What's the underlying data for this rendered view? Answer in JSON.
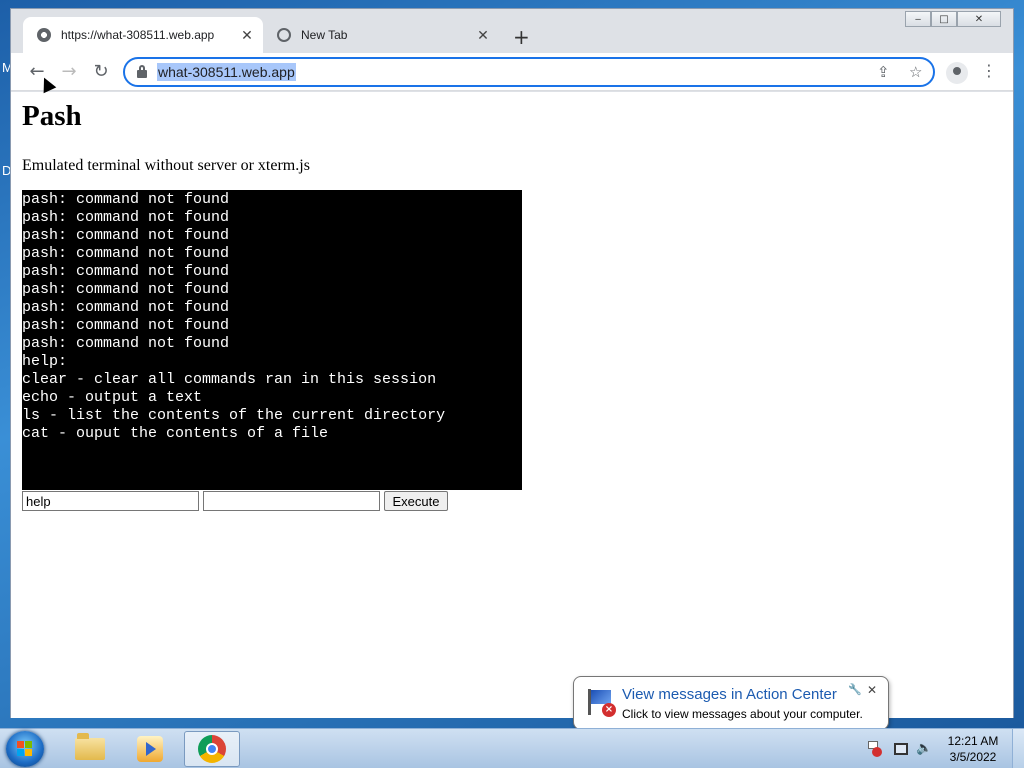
{
  "desktop": {
    "fragments": [
      "M",
      "D"
    ]
  },
  "browser": {
    "tabs": [
      {
        "title": "https://what-308511.web.app",
        "active": true
      },
      {
        "title": "New Tab",
        "active": false
      }
    ],
    "new_tab_label": "+",
    "tab_close_label": "✕",
    "address_bar": {
      "url": "what-308511.web.app"
    },
    "window_controls": {
      "minimize": "‒",
      "maximize": "□",
      "close": "✕"
    }
  },
  "page": {
    "heading": "Pash",
    "description": "Emulated terminal without server or xterm.js",
    "terminal_lines": [
      "pash: command not found",
      "pash: command not found",
      "pash: command not found",
      "pash: command not found",
      "pash: command not found",
      "pash: command not found",
      "pash: command not found",
      "pash: command not found",
      "pash: command not found",
      "help:",
      "clear - clear all commands ran in this session",
      "echo - output a text",
      "ls - list the contents of the current directory",
      "cat - ouput the contents of a file"
    ],
    "command_input": {
      "value": "help"
    },
    "argument_input": {
      "value": ""
    },
    "execute_label": "Execute"
  },
  "notification": {
    "title": "View messages in Action Center",
    "body": "Click to view messages about your computer.",
    "close_label": "✕",
    "settings_label": "🔧"
  },
  "taskbar": {
    "clock_time": "12:21 AM",
    "clock_date": "3/5/2022",
    "pinned": [
      "file-explorer",
      "media-player",
      "chrome"
    ]
  }
}
